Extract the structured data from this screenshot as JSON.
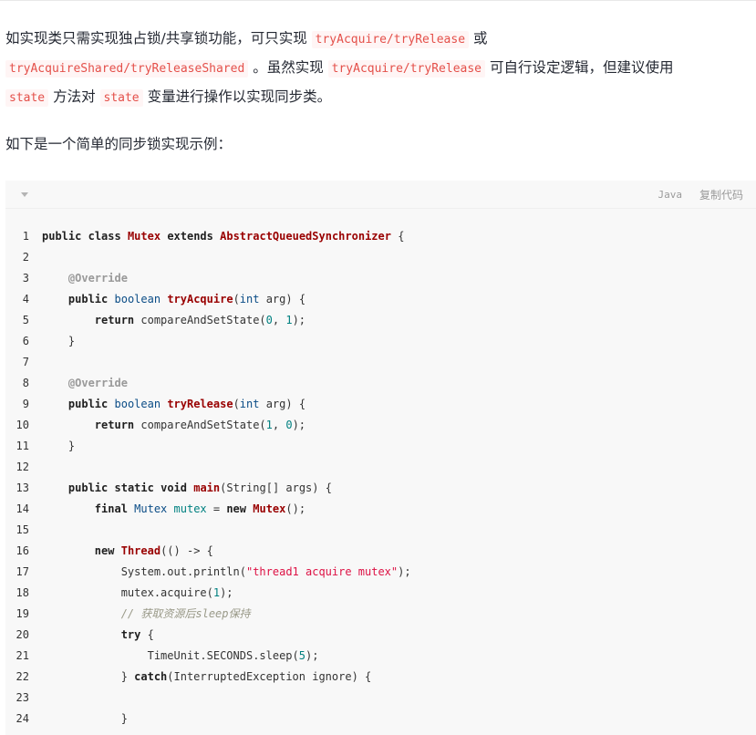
{
  "paragraph1": {
    "t1": "如实现类只需实现独占锁/共享锁功能，可只实现 ",
    "c1": "tryAcquire/tryRelease",
    "t2": " 或",
    "c2": "tryAcquireShared/tryReleaseShared",
    "t3": " 。虽然实现 ",
    "c3": "tryAcquire/tryRelease",
    "t4": " 可自行设定逻辑，但建议使用",
    "c4": "state",
    "t5": " 方法对 ",
    "c5": "state",
    "t6": " 变量进行操作以实现同步类。"
  },
  "paragraph2": {
    "text": "如下是一个简单的同步锁实现示例："
  },
  "codeblock": {
    "language": "Java",
    "copy_label": "复制代码",
    "fold_icon": "chevron-down-icon",
    "lines": [
      {
        "n": "1",
        "segs": [
          {
            "c": "kw",
            "t": "public"
          },
          {
            "t": " "
          },
          {
            "c": "kw",
            "t": "class"
          },
          {
            "t": " "
          },
          {
            "c": "cls",
            "t": "Mutex"
          },
          {
            "t": " "
          },
          {
            "c": "kw",
            "t": "extends"
          },
          {
            "t": " "
          },
          {
            "c": "cls",
            "t": "AbstractQueuedSynchronizer"
          },
          {
            "t": " {"
          }
        ]
      },
      {
        "n": "2",
        "segs": []
      },
      {
        "n": "3",
        "segs": [
          {
            "t": "    "
          },
          {
            "c": "at",
            "t": "@Override"
          }
        ]
      },
      {
        "n": "4",
        "segs": [
          {
            "t": "    "
          },
          {
            "c": "kw",
            "t": "public"
          },
          {
            "t": " "
          },
          {
            "c": "ty",
            "t": "boolean"
          },
          {
            "t": " "
          },
          {
            "c": "fn",
            "t": "tryAcquire"
          },
          {
            "t": "("
          },
          {
            "c": "ty",
            "t": "int"
          },
          {
            "t": " arg) {"
          }
        ]
      },
      {
        "n": "5",
        "segs": [
          {
            "t": "        "
          },
          {
            "c": "kw",
            "t": "return"
          },
          {
            "t": " compareAndSetState("
          },
          {
            "c": "num",
            "t": "0"
          },
          {
            "t": ", "
          },
          {
            "c": "num",
            "t": "1"
          },
          {
            "t": ");"
          }
        ]
      },
      {
        "n": "6",
        "segs": [
          {
            "t": "    }"
          }
        ]
      },
      {
        "n": "7",
        "segs": []
      },
      {
        "n": "8",
        "segs": [
          {
            "t": "    "
          },
          {
            "c": "at",
            "t": "@Override"
          }
        ]
      },
      {
        "n": "9",
        "segs": [
          {
            "t": "    "
          },
          {
            "c": "kw",
            "t": "public"
          },
          {
            "t": " "
          },
          {
            "c": "ty",
            "t": "boolean"
          },
          {
            "t": " "
          },
          {
            "c": "fn",
            "t": "tryRelease"
          },
          {
            "t": "("
          },
          {
            "c": "ty",
            "t": "int"
          },
          {
            "t": " arg) {"
          }
        ]
      },
      {
        "n": "10",
        "segs": [
          {
            "t": "        "
          },
          {
            "c": "kw",
            "t": "return"
          },
          {
            "t": " compareAndSetState("
          },
          {
            "c": "num",
            "t": "1"
          },
          {
            "t": ", "
          },
          {
            "c": "num",
            "t": "0"
          },
          {
            "t": ");"
          }
        ]
      },
      {
        "n": "11",
        "segs": [
          {
            "t": "    }"
          }
        ]
      },
      {
        "n": "12",
        "segs": []
      },
      {
        "n": "13",
        "segs": [
          {
            "t": "    "
          },
          {
            "c": "kw",
            "t": "public"
          },
          {
            "t": " "
          },
          {
            "c": "kw",
            "t": "static"
          },
          {
            "t": " "
          },
          {
            "c": "kw",
            "t": "void"
          },
          {
            "t": " "
          },
          {
            "c": "fn",
            "t": "main"
          },
          {
            "t": "(String[] args) {"
          }
        ]
      },
      {
        "n": "14",
        "segs": [
          {
            "t": "        "
          },
          {
            "c": "kw",
            "t": "final"
          },
          {
            "t": " "
          },
          {
            "c": "ty",
            "t": "Mutex"
          },
          {
            "t": " "
          },
          {
            "c": "var",
            "t": "mutex"
          },
          {
            "t": " = "
          },
          {
            "c": "kw",
            "t": "new"
          },
          {
            "t": " "
          },
          {
            "c": "cls",
            "t": "Mutex"
          },
          {
            "t": "();"
          }
        ]
      },
      {
        "n": "15",
        "segs": []
      },
      {
        "n": "16",
        "segs": [
          {
            "t": "        "
          },
          {
            "c": "kw",
            "t": "new"
          },
          {
            "t": " "
          },
          {
            "c": "cls",
            "t": "Thread"
          },
          {
            "t": "(() -> {"
          }
        ]
      },
      {
        "n": "17",
        "segs": [
          {
            "t": "            System.out.println("
          },
          {
            "c": "str",
            "t": "\"thread1 acquire mutex\""
          },
          {
            "t": ");"
          }
        ]
      },
      {
        "n": "18",
        "segs": [
          {
            "t": "            mutex.acquire("
          },
          {
            "c": "num",
            "t": "1"
          },
          {
            "t": ");"
          }
        ]
      },
      {
        "n": "19",
        "segs": [
          {
            "t": "            "
          },
          {
            "c": "cm",
            "t": "// 获取资源后sleep保持"
          }
        ]
      },
      {
        "n": "20",
        "segs": [
          {
            "t": "            "
          },
          {
            "c": "kw",
            "t": "try"
          },
          {
            "t": " {"
          }
        ]
      },
      {
        "n": "21",
        "segs": [
          {
            "t": "                TimeUnit.SECONDS.sleep("
          },
          {
            "c": "num",
            "t": "5"
          },
          {
            "t": ");"
          }
        ]
      },
      {
        "n": "22",
        "segs": [
          {
            "t": "            } "
          },
          {
            "c": "kw",
            "t": "catch"
          },
          {
            "t": "(InterruptedException ignore) {"
          }
        ]
      },
      {
        "n": "23",
        "segs": []
      },
      {
        "n": "24",
        "segs": [
          {
            "t": "            }"
          }
        ]
      }
    ]
  }
}
